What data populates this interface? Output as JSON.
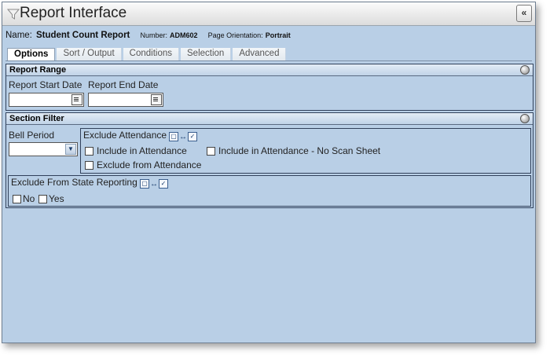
{
  "window": {
    "title": "Report Interface",
    "collapse_label": "«"
  },
  "report": {
    "name_label": "Name:",
    "name": "Student Count Report",
    "number_label": "Number:",
    "number": "ADM602",
    "orientation_label": "Page Orientation:",
    "orientation": "Portrait"
  },
  "tabs": [
    {
      "label": "Options",
      "active": true
    },
    {
      "label": "Sort / Output",
      "active": false
    },
    {
      "label": "Conditions",
      "active": false
    },
    {
      "label": "Selection",
      "active": false
    },
    {
      "label": "Advanced",
      "active": false
    }
  ],
  "report_range": {
    "heading": "Report Range",
    "start_label": "Report Start Date",
    "start_value": "",
    "end_label": "Report End Date",
    "end_value": ""
  },
  "section_filter": {
    "heading": "Section Filter",
    "bell_period_label": "Bell Period",
    "bell_period_value": "",
    "exclude_attendance_label": "Exclude Attendance",
    "options": {
      "include": "Include in Attendance",
      "include_no_scan": "Include in Attendance - No Scan Sheet",
      "exclude": "Exclude from Attendance"
    },
    "exclude_state_label": "Exclude From State Reporting",
    "state_options": {
      "no": "No",
      "yes": "Yes"
    }
  },
  "icons": {
    "funnel": "funnel-icon",
    "calendar": "calendar-icon",
    "compare": "compare-toggle-icon",
    "circle": "section-toggle-icon"
  },
  "colors": {
    "background": "#b9cfe6",
    "header_gradient_top": "#e3ecf6",
    "border": "#30405a"
  }
}
